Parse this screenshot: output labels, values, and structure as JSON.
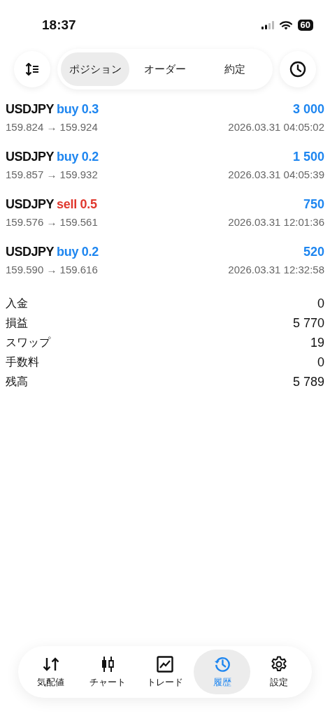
{
  "status_bar": {
    "time": "18:37",
    "battery": "60"
  },
  "toolbar": {
    "tabs": [
      {
        "label": "ポジション",
        "selected": true
      },
      {
        "label": "オーダー",
        "selected": false
      },
      {
        "label": "約定",
        "selected": false
      }
    ]
  },
  "trades": [
    {
      "symbol": "USDJPY",
      "kind": "buy",
      "action": "buy 0.3",
      "profit": "3 000",
      "prices": "159.824 → 159.924",
      "time": "2026.03.31 04:05:02"
    },
    {
      "symbol": "USDJPY",
      "kind": "buy",
      "action": "buy 0.2",
      "profit": "1 500",
      "prices": "159.857 → 159.932",
      "time": "2026.03.31 04:05:39"
    },
    {
      "symbol": "USDJPY",
      "kind": "sell",
      "action": "sell 0.5",
      "profit": "750",
      "prices": "159.576 → 159.561",
      "time": "2026.03.31 12:01:36"
    },
    {
      "symbol": "USDJPY",
      "kind": "buy",
      "action": "buy 0.2",
      "profit": "520",
      "prices": "159.590 → 159.616",
      "time": "2026.03.31 12:32:58"
    }
  ],
  "summary": [
    {
      "label": "入金",
      "value": "0"
    },
    {
      "label": "損益",
      "value": "5 770"
    },
    {
      "label": "スワップ",
      "value": "19"
    },
    {
      "label": "手数料",
      "value": "0"
    },
    {
      "label": "残高",
      "value": "5 789"
    }
  ],
  "tab_bar": [
    {
      "kind": "quotes",
      "label": "気配値",
      "selected": false
    },
    {
      "kind": "chart",
      "label": "チャート",
      "selected": false
    },
    {
      "kind": "trade",
      "label": "トレード",
      "selected": false
    },
    {
      "kind": "history",
      "label": "履歴",
      "selected": true
    },
    {
      "kind": "settings",
      "label": "設定",
      "selected": false
    }
  ]
}
